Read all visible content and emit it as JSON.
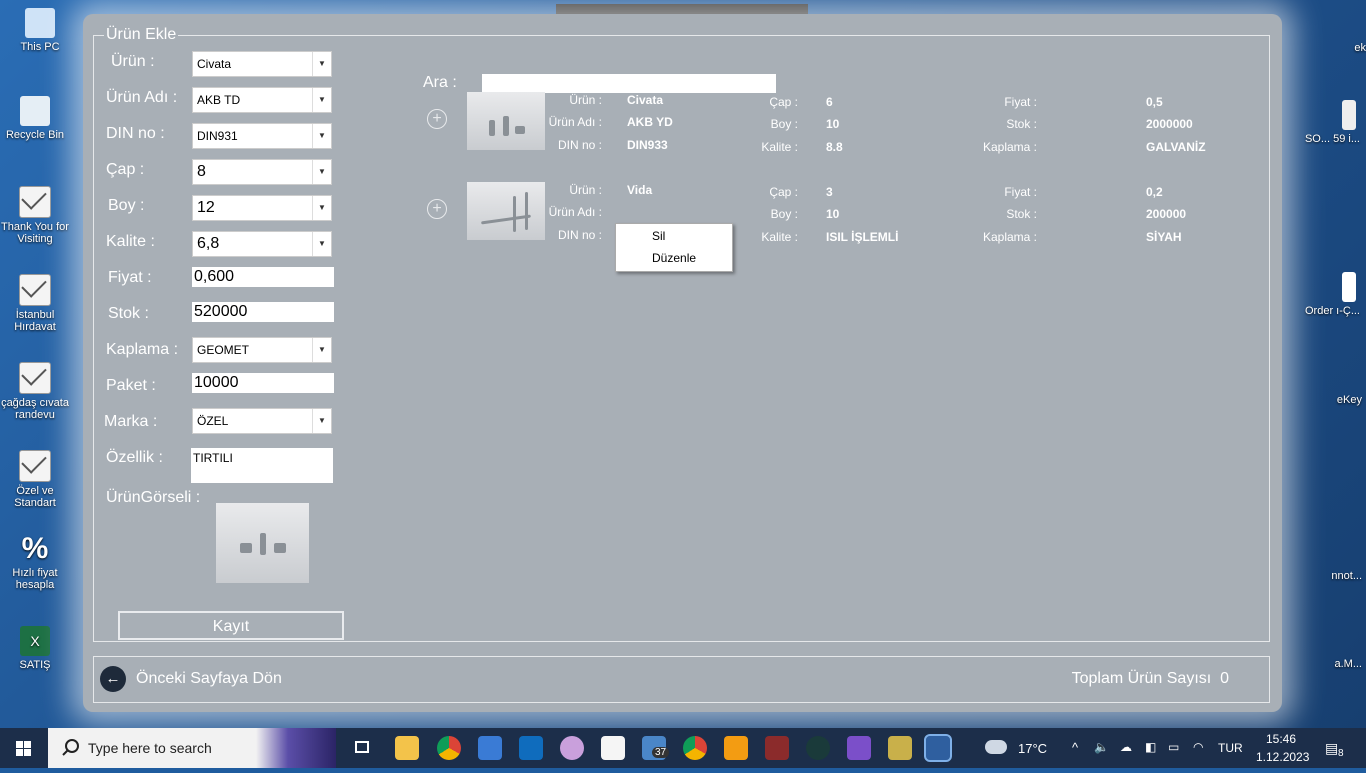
{
  "desktop": {
    "left_icons": [
      "This PC",
      "Recycle Bin",
      "Thank You for Visiting",
      "İstanbul Hırdavat",
      "çağdaş cıvata randevu",
      "Özel ve Standart",
      "Hızlı fiyat hesapla",
      "SATIŞ"
    ],
    "right_icons": [
      "ek",
      "SO... 59 i...",
      "Order ı-Ç...",
      "eKey",
      "nnot...",
      "a.M..."
    ]
  },
  "form": {
    "group_title": "Ürün Ekle",
    "urun_label": "Ürün :",
    "urun_value": "Civata",
    "urun_adi_label": "Ürün Adı :",
    "urun_adi_value": "AKB TD",
    "din_label": "DIN no :",
    "din_value": "DIN931",
    "cap_label": "Çap :",
    "cap_value": "8",
    "boy_label": "Boy :",
    "boy_value": "12",
    "kalite_label": "Kalite :",
    "kalite_value": "6,8",
    "fiyat_label": "Fiyat :",
    "fiyat_value": "0,600",
    "stok_label": "Stok :",
    "stok_value": "520000",
    "kaplama_label": "Kaplama :",
    "kaplama_value": "GEOMET",
    "paket_label": "Paket :",
    "paket_value": "10000",
    "marka_label": "Marka :",
    "marka_value": "ÖZEL",
    "ozellik_label": "Özellik :",
    "ozellik_value": "TIRTILI",
    "gorsel_label": "ÜrünGörseli :",
    "save_label": "Kayıt"
  },
  "search": {
    "label": "Ara :",
    "value": ""
  },
  "products": [
    {
      "urun_k": "Ürün :",
      "urun": "Civata",
      "adi_k": "Ürün Adı :",
      "adi": "AKB YD",
      "din_k": "DIN no :",
      "din": "DIN933",
      "cap_k": "Çap :",
      "cap": "6",
      "boy_k": "Boy :",
      "boy": "10",
      "kalite_k": "Kalite :",
      "kalite": "8.8",
      "fiyat_k": "Fiyat :",
      "fiyat": "0,5",
      "stok_k": "Stok :",
      "stok": "2000000",
      "kaplama_k": "Kaplama :",
      "kaplama": "GALVANİZ"
    },
    {
      "urun_k": "Ürün :",
      "urun": "Vida",
      "adi_k": "Ürün Adı :",
      "adi": "",
      "din_k": "DIN no :",
      "din": "",
      "cap_k": "Çap :",
      "cap": "3",
      "boy_k": "Boy :",
      "boy": "10",
      "kalite_k": "Kalite :",
      "kalite": "ISIL İŞLEMLİ",
      "fiyat_k": "Fiyat :",
      "fiyat": "0,2",
      "stok_k": "Stok :",
      "stok": "200000",
      "kaplama_k": "Kaplama :",
      "kaplama": "SİYAH"
    }
  ],
  "context_menu": {
    "delete": "Sil",
    "edit": "Düzenle"
  },
  "footer": {
    "back": "Önceki Sayfaya Dön",
    "total_label": "Toplam Ürün Sayısı",
    "total_value": "0"
  },
  "taskbar": {
    "search_placeholder": "Type here to search",
    "badge_count": "37",
    "weather": "17°C",
    "language": "TUR",
    "time": "15:46",
    "date": "1.12.2023",
    "notifications": "8"
  }
}
